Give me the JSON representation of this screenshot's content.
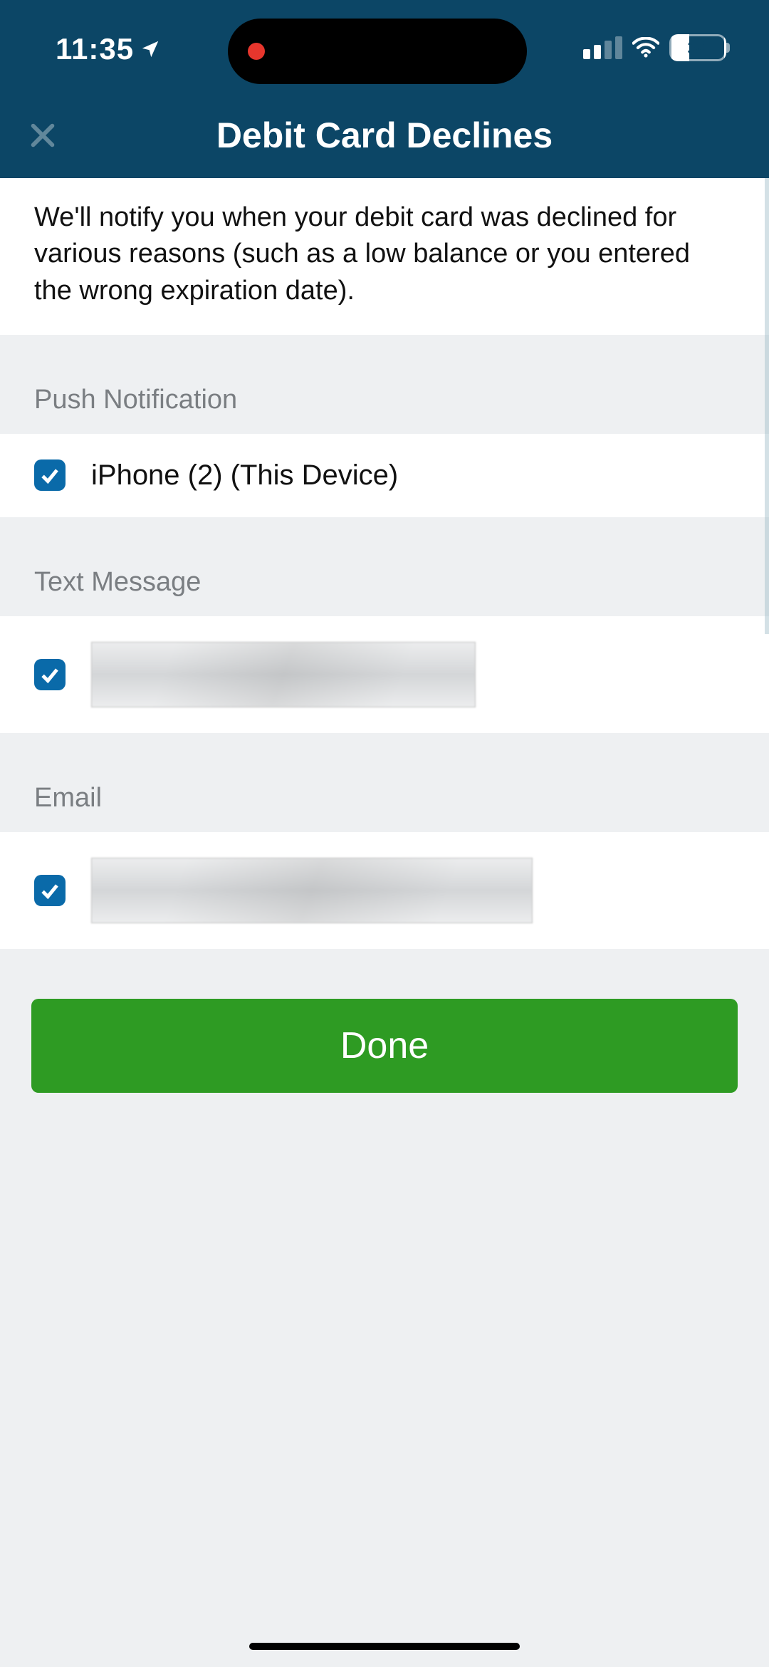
{
  "status": {
    "time": "11:35",
    "battery_pct": "34"
  },
  "header": {
    "title": "Debit Card Declines"
  },
  "description": "We'll notify you when your debit card was declined for various reasons (such as a low balance or you entered the wrong expiration date).",
  "sections": {
    "push": {
      "header": "Push Notification",
      "item_label": "iPhone (2) (This Device)",
      "checked": true
    },
    "text": {
      "header": "Text Message",
      "checked": true
    },
    "email": {
      "header": "Email",
      "checked": true
    }
  },
  "actions": {
    "done_label": "Done"
  }
}
